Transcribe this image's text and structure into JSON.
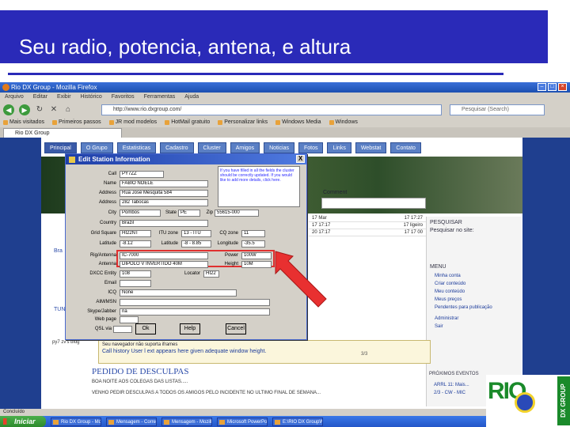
{
  "slide": {
    "title": "Seu radio, potencia, antena, e altura"
  },
  "browser": {
    "window_title": "Rio DX Group - Mozilla Firefox",
    "menu": [
      "Arquivo",
      "Editar",
      "Exibir",
      "Histórico",
      "Favoritos",
      "Ferramentas",
      "Ajuda"
    ],
    "url": "http://www.rio.dxgroup.com/",
    "search_placeholder": "Pesquisar (Search)",
    "bookmarks": [
      "Mais visitados",
      "Primeiros passos",
      "JR mod modelos",
      "HotMail gratuito",
      "Personalizar links",
      "Windows Media",
      "Windows"
    ],
    "tab_label": "Rio DX Group"
  },
  "site": {
    "nav": [
      "Principal",
      "O Grupo",
      "Estatisticas",
      "Cadastro",
      "Cluster",
      "Amigos",
      "Noticias",
      "Fotos",
      "Links",
      "Webstat",
      "Contato"
    ],
    "comment_label": "Comment",
    "table_rows": [
      [
        "17 Mar",
        "17 17:27"
      ],
      [
        "17 17:17",
        "17 ligeiro"
      ],
      [
        "20 17:17",
        "17 17 00"
      ]
    ],
    "right": {
      "search_label": "PESQUISAR",
      "search_sub": "Pesquisar no site:",
      "search_btn": "PESQUISAR",
      "menu_title": "MENU",
      "links": [
        "Minha conta",
        "Criar conteúdo",
        "Meu conteúdo",
        "Meus preços",
        "Pendentes para publicação",
        "Administrar",
        "Sair"
      ],
      "events_title": "PRÓXIMOS EVENTOS",
      "events": [
        "ARRL 11: Mais...",
        "2/3 - CW - MIC"
      ]
    },
    "left_stub": [
      "Bra",
      "TUN"
    ],
    "qrz_label": "py7 zv's blog",
    "notice_line1": "Seu navegador não suporta iframes",
    "notice_line2": "Call history User l ext appears here given adequate window height.",
    "notice_counter": "3/3",
    "apology_title": "PEDIDO DE DESCULPAS",
    "apology_text1": "BOA NOITE AOS COLEGAS DAS LISTAS.....",
    "apology_text2": "VENHO PEDIR DESCULPAS A TODOS OS AMIGOS PELO INCIDENTE NO ULTIMO FINAL DE SEMANA..."
  },
  "dialog": {
    "title": "Edit Station Information",
    "close_glyph": "X",
    "fields": {
      "call_label": "Call",
      "call_value": "PY7ZZ",
      "name_label": "Name",
      "name_value": "FABIO NOELE",
      "address_label": "Address",
      "address_value": "Rua Jose Mesquita 584",
      "address2_label": "Address",
      "address2_value": "282 Tabocas",
      "city_label": "City",
      "city_value": "Pombos",
      "state_label": "State",
      "state_value": "PE",
      "zip_label": "Zip",
      "zip_value": "55615-000",
      "country_label": "Country",
      "country_value": "Brazil",
      "grid_label": "Grid Square",
      "grid_value": "HI22NT",
      "itu_label": "ITU zone",
      "itu_value": "13 - ITU",
      "cq_label": "CQ zone",
      "cq_value": "11",
      "lat_label": "Latitude",
      "lat_value": "-8.12",
      "lat2_label": "Latitude",
      "lat2_value": "-8 - 8.85",
      "lon_label": "Longitude",
      "lon_value": "-35.5",
      "rig_label": "Rig/Antenna",
      "rig_value": "IC-7000",
      "power_label": "Power",
      "power_value": "100W",
      "antenna_label": "Antenna",
      "antenna_value": "DIPOLO V INVERTIDO 40M",
      "height_label": "Height",
      "height_value": "10M",
      "dxcc_label": "DXCC Entity",
      "dxcc_value": "108",
      "email_label": "Email",
      "email_value": "",
      "web_label": "Web page",
      "web_value": "",
      "icq_label": "ICQ",
      "icq_value": "None",
      "aim_label": "AIM/MSN",
      "aim_value": "",
      "skype_label": "Skype/Jabber",
      "skype_value": "na",
      "qsl_label": "QSL via",
      "qsl_value": "",
      "locator_label": "Locator",
      "locator_value": "HI22"
    },
    "info_text": "If you have filled in all the fields the cluster should be correctly updated. If you would like to add more details, click here.",
    "buttons": [
      "Ok",
      "Help",
      "Cancel"
    ]
  },
  "statusbar_text": "Concluído",
  "taskbar": {
    "start_label": "Iniciar",
    "items": [
      "Rio DX Group - Mozilla Firefox",
      "Mensagem - Correio",
      "Mensagem - Mozilla",
      "Microsoft PowerPoint",
      "E:\\RIO DX Group\\Manual"
    ]
  },
  "logo": {
    "text": "RIO",
    "side_text": "DX GROUP"
  },
  "colors": {
    "title_band": "#2a2ab8",
    "highlight": "#e03030",
    "arrow": "#e83030",
    "logo_green": "#1a8a2a"
  }
}
